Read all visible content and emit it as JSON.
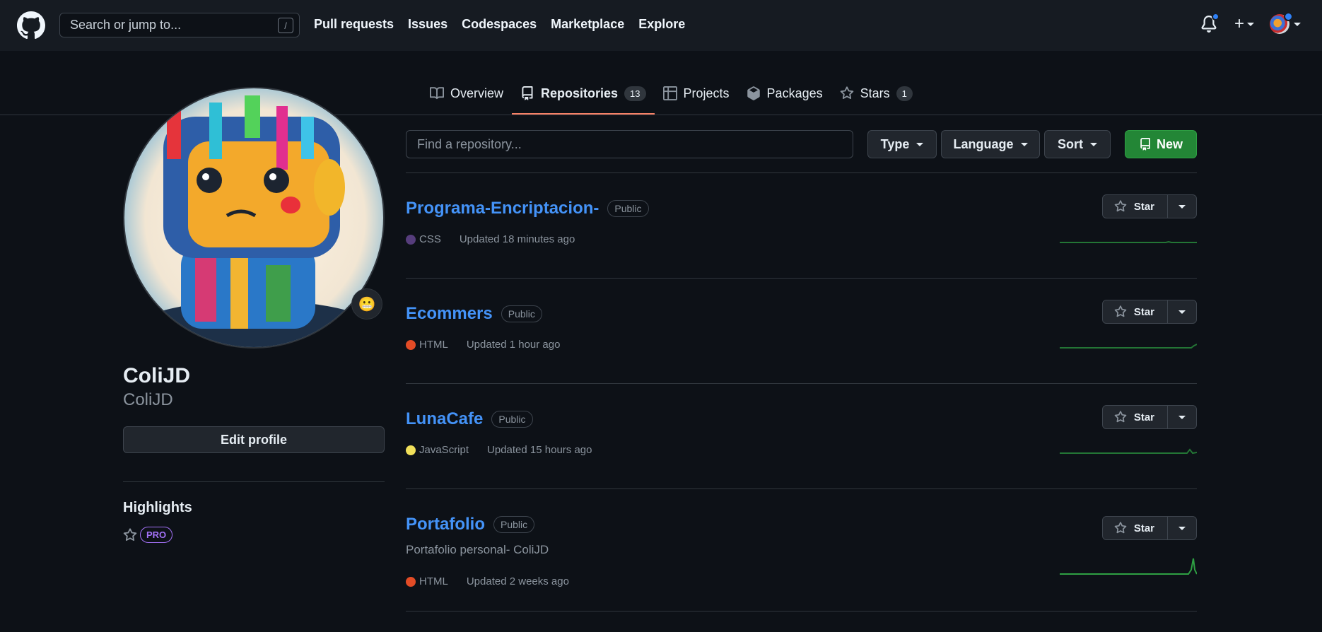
{
  "header": {
    "search_placeholder": "Search or jump to...",
    "search_shortcut": "/",
    "nav": [
      "Pull requests",
      "Issues",
      "Codespaces",
      "Marketplace",
      "Explore"
    ],
    "plus_label": "+"
  },
  "tabs": [
    {
      "label": "Overview",
      "icon": "book-icon"
    },
    {
      "label": "Repositories",
      "count": "13",
      "icon": "repo-icon",
      "active": true
    },
    {
      "label": "Projects",
      "icon": "table-icon"
    },
    {
      "label": "Packages",
      "icon": "package-icon"
    },
    {
      "label": "Stars",
      "count": "1",
      "icon": "star-icon"
    }
  ],
  "profile": {
    "name": "ColiJD",
    "login": "ColiJD",
    "status_emoji": "😬",
    "edit_label": "Edit profile",
    "highlights_title": "Highlights",
    "pro_badge": "PRO"
  },
  "filters": {
    "find_placeholder": "Find a repository...",
    "type_label": "Type",
    "language_label": "Language",
    "sort_label": "Sort",
    "new_label": "New"
  },
  "repos": [
    {
      "name": "Programa-Encriptacion-",
      "visibility": "Public",
      "description": "",
      "language": "CSS",
      "lang_color": "#563d7c",
      "updated": "Updated 18 minutes ago",
      "star_label": "Star"
    },
    {
      "name": "Ecommers",
      "visibility": "Public",
      "description": "",
      "language": "HTML",
      "lang_color": "#e34c26",
      "updated": "Updated 1 hour ago",
      "star_label": "Star"
    },
    {
      "name": "LunaCafe",
      "visibility": "Public",
      "description": "",
      "language": "JavaScript",
      "lang_color": "#f1e05a",
      "updated": "Updated 15 hours ago",
      "star_label": "Star"
    },
    {
      "name": "Portafolio",
      "visibility": "Public",
      "description": "Portafolio personal- ColiJD",
      "language": "HTML",
      "lang_color": "#e34c26",
      "updated": "Updated 2 weeks ago",
      "star_label": "Star"
    }
  ],
  "colors": {
    "accent": "#2f81f7",
    "link": "#4493f8",
    "new_button": "#238636",
    "tab_underline": "#f78166",
    "sparkline": "#2ea043"
  }
}
